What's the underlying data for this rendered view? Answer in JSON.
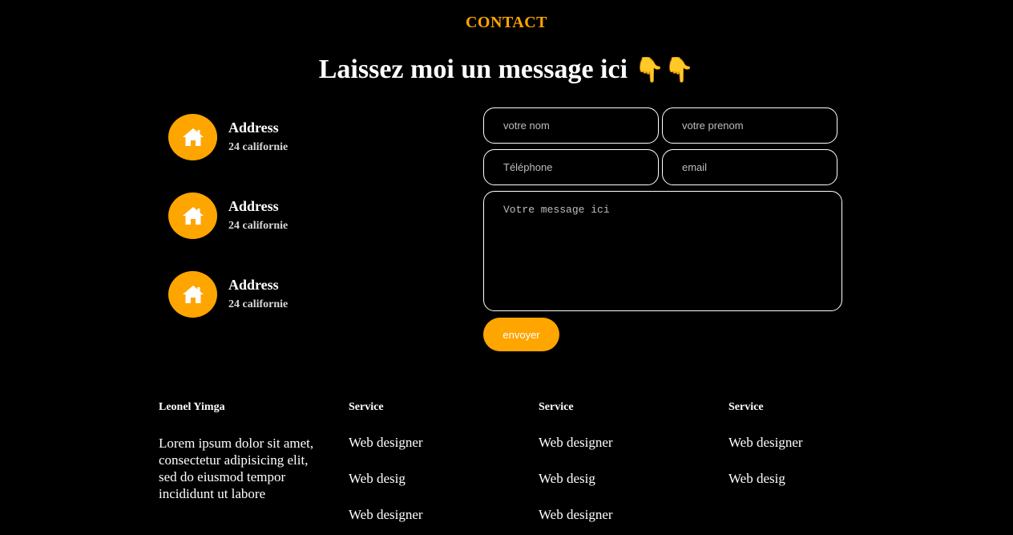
{
  "section": {
    "label": "CONTACT"
  },
  "heading": {
    "text": "Laissez moi un message ici",
    "emoji": "👇👇"
  },
  "accent_color": "#ffa500",
  "contacts": [
    {
      "icon": "home-icon",
      "title": "Address",
      "value": "24 californie"
    },
    {
      "icon": "home-icon",
      "title": "Address",
      "value": "24 californie"
    },
    {
      "icon": "home-icon",
      "title": "Address",
      "value": "24 californie"
    }
  ],
  "form": {
    "nom_placeholder": "votre nom",
    "prenom_placeholder": "votre prenom",
    "telephone_placeholder": "Téléphone",
    "email_placeholder": "email",
    "message_placeholder": "Votre message ici",
    "submit_label": "envoyer"
  },
  "footer": {
    "about": {
      "title": "Leonel Yimga",
      "text": "Lorem ipsum dolor sit amet, consectetur adipisicing elit, sed do eiusmod tempor incididunt ut labore"
    },
    "columns": [
      {
        "title": "Service",
        "links": [
          "Web designer",
          "Web desig",
          "Web designer"
        ]
      },
      {
        "title": "Service",
        "links": [
          "Web designer",
          "Web desig",
          "Web designer"
        ]
      },
      {
        "title": "Service",
        "links": [
          "Web designer",
          "Web desig"
        ]
      }
    ]
  }
}
